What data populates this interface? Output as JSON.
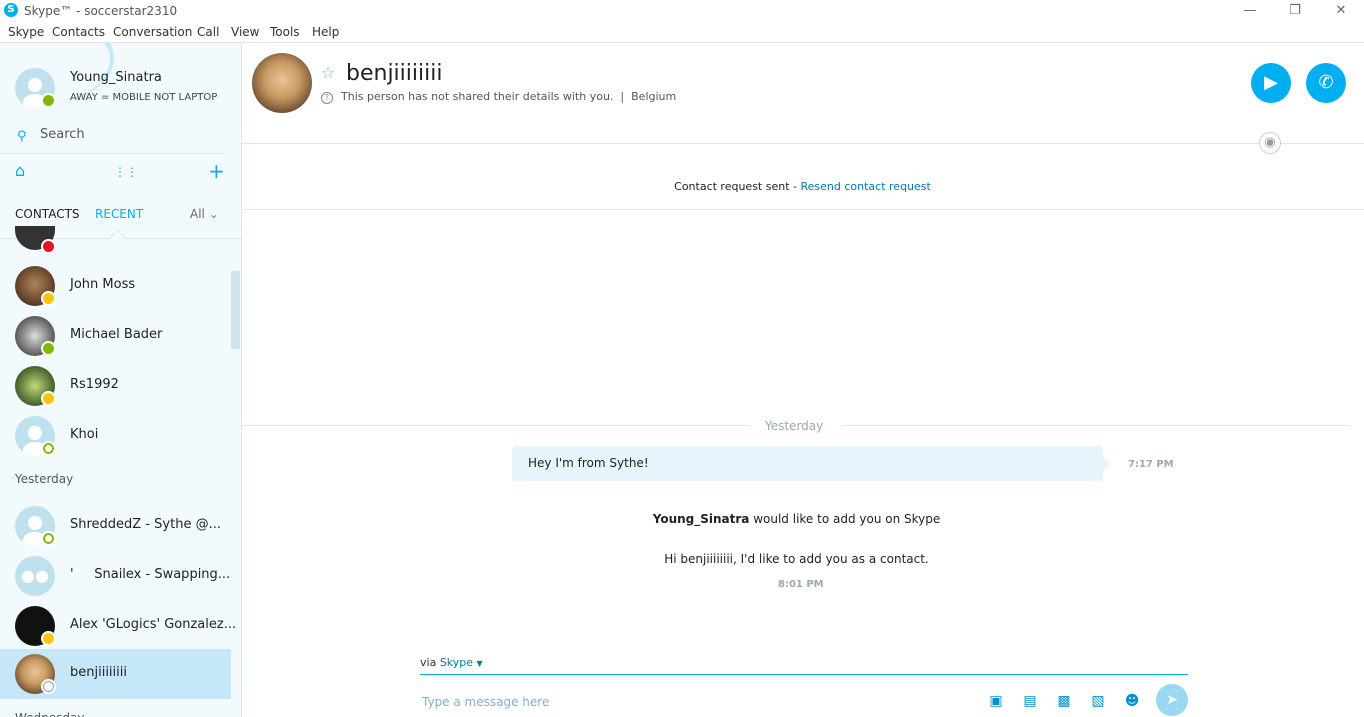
{
  "window": {
    "title": "Skype™ - soccerstar2310"
  },
  "menu": [
    "Skype",
    "Contacts",
    "Conversation",
    "Call",
    "View",
    "Tools",
    "Help"
  ],
  "me": {
    "name": "Young_Sinatra",
    "status_message": "AWAY = MOBILE NOT LAPTOP"
  },
  "search": {
    "placeholder": "Search"
  },
  "tabs": {
    "contacts": "CONTACTS",
    "recent": "RECENT",
    "filter": "All"
  },
  "contacts": [
    {
      "name": "John Moss",
      "status": "away"
    },
    {
      "name": "Michael Bader",
      "status": "online"
    },
    {
      "name": "Rs1992",
      "status": "away"
    },
    {
      "name": "Khoi",
      "status": "offline"
    }
  ],
  "sections": {
    "yesterday": "Yesterday",
    "partial": "Wednesday"
  },
  "contacts_yesterday": [
    {
      "name": "ShreddedZ - Sythe @...",
      "status": "offline"
    },
    {
      "name": "'     Snailex - Swapping...",
      "status": "group"
    },
    {
      "name": "Alex 'GLogics' Gonzalez...",
      "status": "away"
    },
    {
      "name": "benjiiiiiiii",
      "status": "unknown",
      "selected": true
    }
  ],
  "conversation": {
    "name": "benjiiiiiiii",
    "details": "This person has not shared their details with you.",
    "location": "Belgium",
    "request_text": "Contact request sent - ",
    "request_link": "Resend contact request",
    "day_divider": "Yesterday",
    "messages": [
      {
        "text": "Hey I'm from Sythe!",
        "time": "7:17 PM"
      }
    ],
    "add_request": {
      "sender": "Young_Sinatra",
      "suffix": " would like to add you on Skype",
      "body": "Hi benjiiiiiiii, I'd like to add you as a contact.",
      "time": "8:01 PM"
    }
  },
  "compose": {
    "via_label": "via ",
    "via_value": "Skype",
    "placeholder": "Type a message here"
  },
  "colors": {
    "accent": "#00aff0",
    "sidebar_bg": "#f2fafe",
    "selected_bg": "#c5e7f7",
    "bubble_bg": "#e6f5fc"
  }
}
